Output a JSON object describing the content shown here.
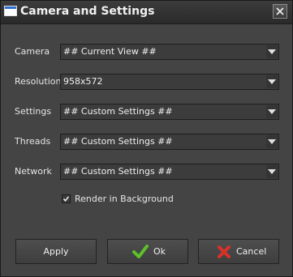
{
  "window": {
    "title": "Camera and Settings",
    "icons": {
      "app": "window-icon",
      "close": "close-icon"
    }
  },
  "form": {
    "rows": [
      {
        "label": "Camera",
        "value": "## Current View ##"
      },
      {
        "label": "Resolution",
        "value": "958x572"
      },
      {
        "label": "Settings",
        "value": "## Custom Settings ##"
      },
      {
        "label": "Threads",
        "value": "## Custom Settings ##"
      },
      {
        "label": "Network",
        "value": "## Custom Settings ##"
      }
    ],
    "render_in_background": {
      "label": "Render in Background",
      "checked": true
    }
  },
  "buttons": {
    "apply": "Apply",
    "ok": "Ok",
    "cancel": "Cancel",
    "ok_icon": "checkmark-icon",
    "cancel_icon": "x-mark-icon"
  },
  "colors": {
    "ok_icon": "#5cc02a",
    "cancel_icon": "#d8322a",
    "background": "#444444"
  }
}
